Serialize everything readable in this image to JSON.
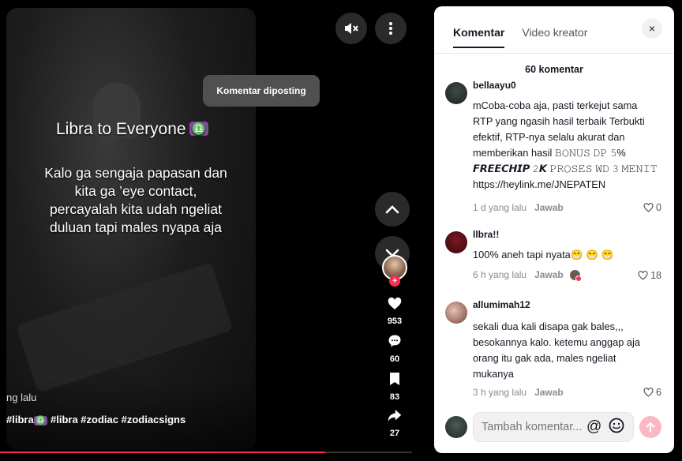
{
  "video": {
    "title": "Libra to Everyone",
    "title_emoji": "♎",
    "caption": "Kalo ga sengaja papasan dan kita ga ’eye contact, percayalah kita udah ngeliat duluan tapi males nyapa aja",
    "time_ago": "ng lalu",
    "hashtags_pre": "#libra",
    "hashtags_emoji": "♎",
    "hashtags_post": " #libra #zodiac #zodiacsigns",
    "progress_fraction": 0.79
  },
  "toast": "Komentar diposting",
  "actions": {
    "likes": "953",
    "comments": "60",
    "saves": "83",
    "shares": "27"
  },
  "icons": {
    "mute": "mute-icon",
    "more": "more-vertical-icon",
    "up": "chevron-up-icon",
    "down": "chevron-down-icon",
    "like": "heart-icon",
    "comment": "comment-icon",
    "save": "bookmark-icon",
    "share": "share-icon"
  },
  "panel": {
    "tabs": [
      "Komentar",
      "Video kreator"
    ],
    "count": "60 komentar",
    "close": "×",
    "comments": [
      {
        "user": "bellaayu0",
        "text_lines": [
          "mCoba-coba aja, pasti terkejut sama",
          "RTP yang ngasih hasil terbaik Terbukti",
          "efektif, RTP-nya selalu akurat dan",
          "memberikan hasil 𝙱𝙾𝙽𝚄𝚂 𝙳𝙿 𝟻%",
          "𝙁𝙍𝙀𝙀𝘾𝙃𝙄𝙋 𝟸𝙆 𝙿𝚁𝙾𝚂𝙴𝚂 𝚆𝙳 𝟹 𝙼𝙴𝙽𝙸𝚃",
          "https://heylink.me/JNEPATEN"
        ],
        "time": "1 d yang lalu",
        "reply": "Jawab",
        "likes": "0"
      },
      {
        "user": "llbra!!",
        "text_lines": [
          "100% aneh tapi nyata😁 😁 😁"
        ],
        "time": "6 h yang lalu",
        "reply": "Jawab",
        "likes": "18"
      },
      {
        "user": "allumimah12",
        "text_lines": [
          "sekali dua kali disapa gak bales,,,",
          "besokannya kalo. ketemu anggap aja",
          "orang itu gak ada, males ngeliat",
          "mukanya"
        ],
        "time": "3 h yang lalu",
        "reply": "Jawab",
        "likes": "6"
      }
    ],
    "input_placeholder": "Tambah komentar...",
    "colors": {
      "accent": "#fe2c55",
      "send_disabled": "#fcb7c4"
    }
  }
}
